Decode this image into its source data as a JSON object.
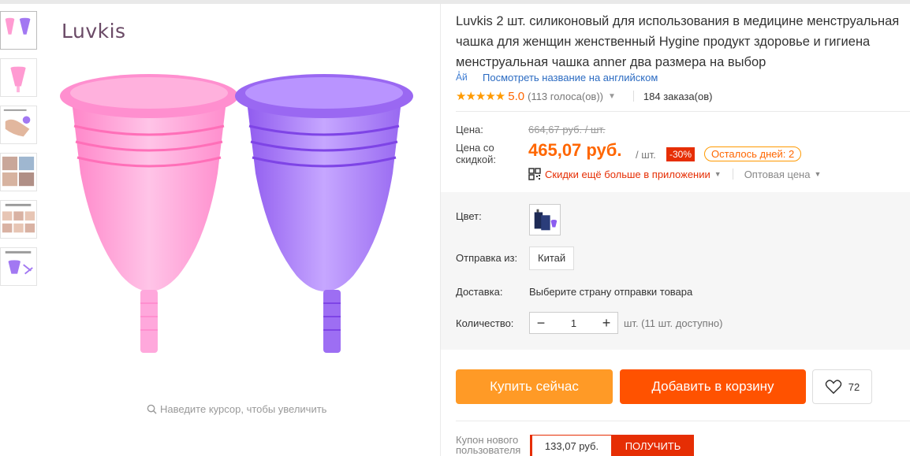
{
  "brand": "Luvkis",
  "product": {
    "title": "Luvkis 2 шт. силиконовый для использования в медицине менструальная чашка для женщин женственный Hygine продукт здоровье и гигиена менструальная чашка anner два размера на выбор",
    "translate_label": "Посмотреть название на английском",
    "translate_icon": "A̓й",
    "stars": "★★★★★",
    "rating": "5.0",
    "votes": "(113 голоса(ов))",
    "orders": "184 заказа(ов)"
  },
  "gallery": {
    "zoom_hint": "Наведите курсор, чтобы увеличить",
    "thumbnails": [
      "thumb-1",
      "thumb-2",
      "thumb-3",
      "thumb-4",
      "thumb-5",
      "thumb-6"
    ]
  },
  "pricing": {
    "price_label": "Цена:",
    "old_price": "664,67 руб. / шт.",
    "discount_label": "Цена со скидкой:",
    "new_price": "465,07 руб.",
    "per_unit": "/ шт.",
    "discount_badge": "-30%",
    "days_left": "Осталось дней: 2",
    "app_discount": "Скидки ещё больше в приложении",
    "wholesale": "Оптовая цена"
  },
  "options": {
    "color_label": "Цвет:",
    "ship_from_label": "Отправка из:",
    "ship_from_value": "Китай",
    "delivery_label": "Доставка:",
    "delivery_value": "Выберите страну отправки товара",
    "quantity_label": "Количество:",
    "quantity_value": "1",
    "quantity_minus": "−",
    "quantity_plus": "+",
    "quantity_note": "шт. (11 шт. доступно)"
  },
  "actions": {
    "buy_now": "Купить сейчас",
    "add_to_cart": "Добавить в корзину",
    "wishlist_count": "72"
  },
  "coupon": {
    "label": "Купон нового пользователя",
    "amount": "133,07 руб.",
    "get_button": "ПОЛУЧИТЬ"
  },
  "colors": {
    "accent": "#ff6600",
    "buy_now": "#ff9a26",
    "add_to_cart": "#ff5200",
    "discount": "#e62e04",
    "link": "#2b6bc2",
    "pink_cup": "#ff8fcf",
    "purple_cup": "#a070f0"
  }
}
